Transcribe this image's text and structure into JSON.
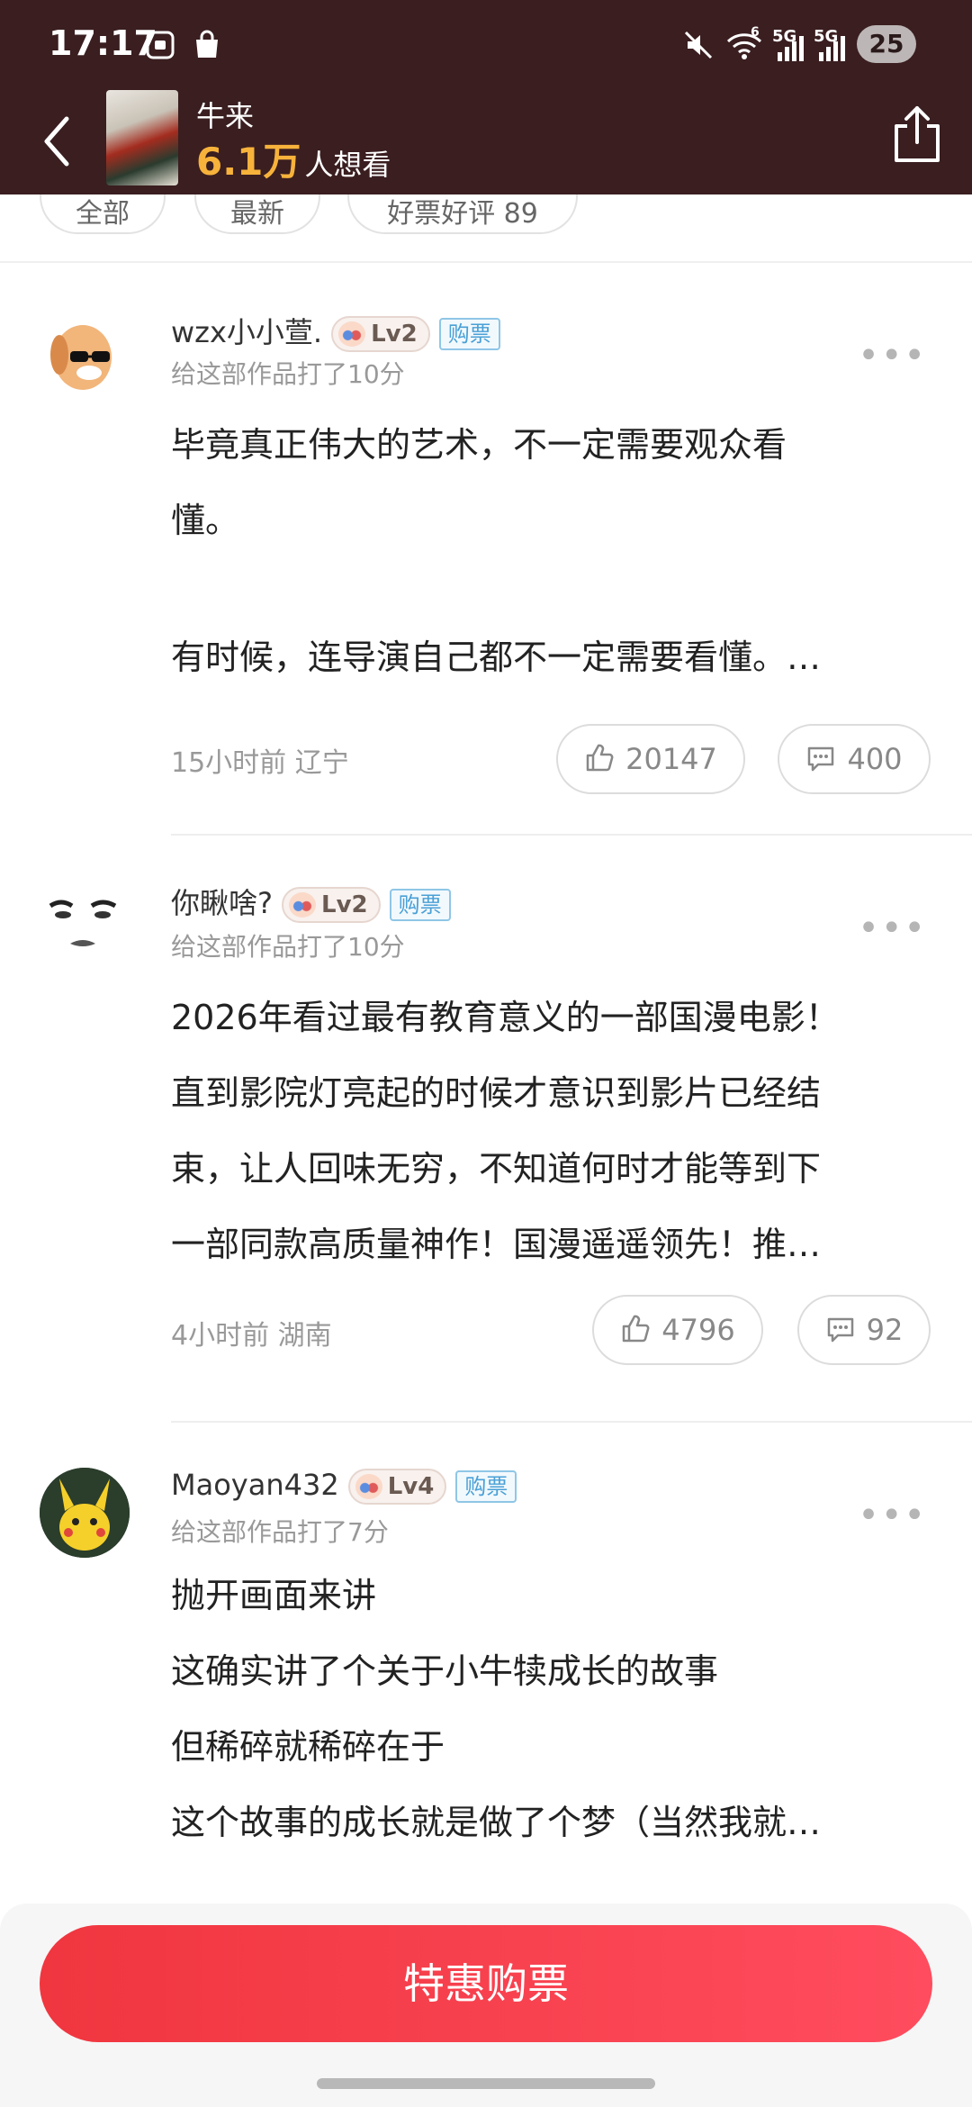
{
  "status": {
    "time": "17:17",
    "battery": "25",
    "network1": "5G",
    "network2": "5G",
    "wifi": "6"
  },
  "header": {
    "movie_title": "牛来",
    "want_count": "6.1万",
    "want_suffix": "人想看"
  },
  "filters": [
    "全部",
    "最新",
    "好票好评 89"
  ],
  "comments": [
    {
      "username": "wzx小小萱.",
      "level": "Lv2",
      "badge": "购票",
      "rating_text": "给这部作品打了10分",
      "lines": [
        "毕竟真正伟大的艺术，不一定需要观众看",
        "懂。",
        "",
        "有时候，连导演自己都不一定需要看懂。…"
      ],
      "time": "15小时前",
      "location": "辽宁",
      "likes": "20147",
      "replies": "400"
    },
    {
      "username": "你瞅啥?",
      "level": "Lv2",
      "badge": "购票",
      "rating_text": "给这部作品打了10分",
      "lines": [
        "2026年看过最有教育意义的一部国漫电影！",
        "直到影院灯亮起的时候才意识到影片已经结",
        "束，让人回味无穷，不知道何时才能等到下",
        "一部同款高质量神作！国漫遥遥领先！推…"
      ],
      "time": "4小时前",
      "location": "湖南",
      "likes": "4796",
      "replies": "92"
    },
    {
      "username": "Maoyan432",
      "level": "Lv4",
      "badge": "购票",
      "rating_text": "给这部作品打了7分",
      "lines": [
        "抛开画面来讲",
        "这确实讲了个关于小牛犊成长的故事",
        "但稀碎就稀碎在于",
        "这个故事的成长就是做了个梦（当然我就…"
      ]
    }
  ],
  "buy_button": "特惠购票",
  "colors": {
    "header_bg": "#3a1e20",
    "accent": "#f7b23b",
    "buy": "#f0363f",
    "ticket_badge": "#4aa0d6"
  }
}
